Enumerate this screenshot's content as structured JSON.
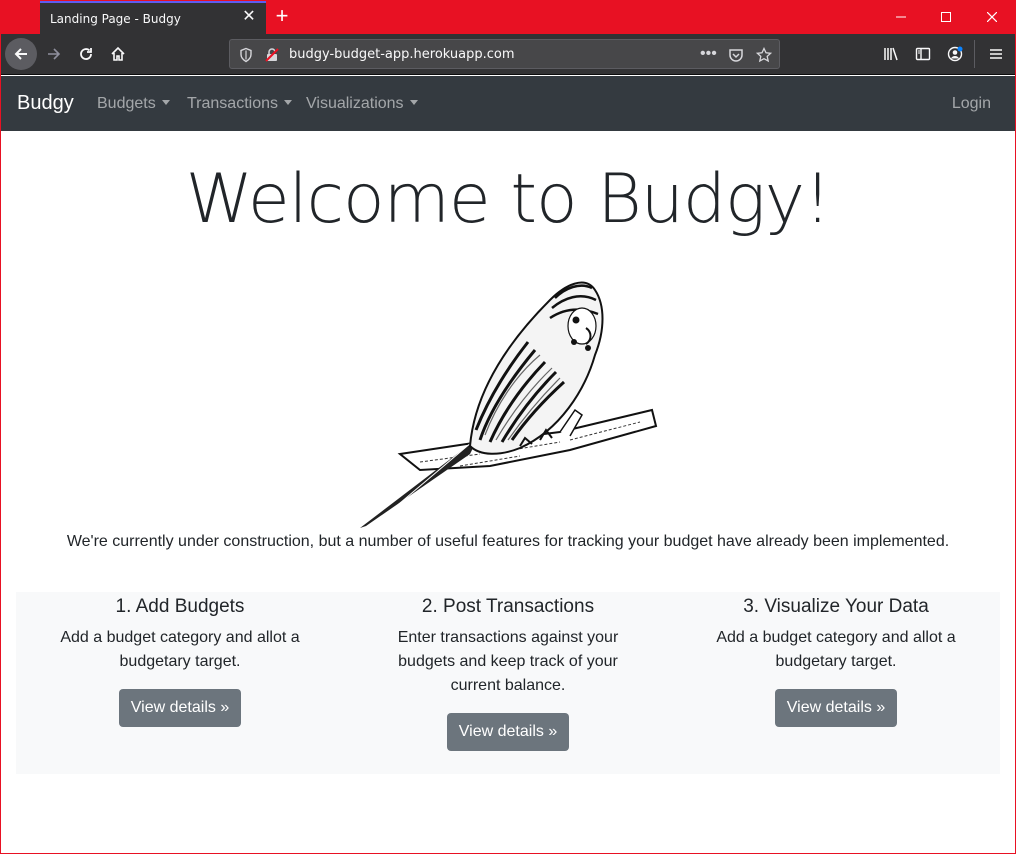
{
  "browser": {
    "tab_title": "Landing Page - Budgy",
    "url": "budgy-budget-app.herokuapp.com"
  },
  "navbar": {
    "brand": "Budgy",
    "items": [
      {
        "label": "Budgets"
      },
      {
        "label": "Transactions"
      },
      {
        "label": "Visualizations"
      }
    ],
    "login": "Login"
  },
  "hero": {
    "title": "Welcome to Budgy!",
    "lead": "We're currently under construction, but a number of useful features for tracking your budget have already been implemented."
  },
  "features": [
    {
      "title": "1. Add Budgets",
      "text": "Add a budget category and allot a budgetary target.",
      "button": "View details »"
    },
    {
      "title": "2. Post Transactions",
      "text": "Enter transactions against your budgets and keep track of your current balance.",
      "button": "View details »"
    },
    {
      "title": "3. Visualize Your Data",
      "text": "Add a budget category and allot a budgetary target.",
      "button": "View details »"
    }
  ],
  "colors": {
    "titlebar": "#e81123",
    "navbar": "#343a40",
    "button": "#6c757d",
    "features_bg": "#f8f9fa"
  }
}
